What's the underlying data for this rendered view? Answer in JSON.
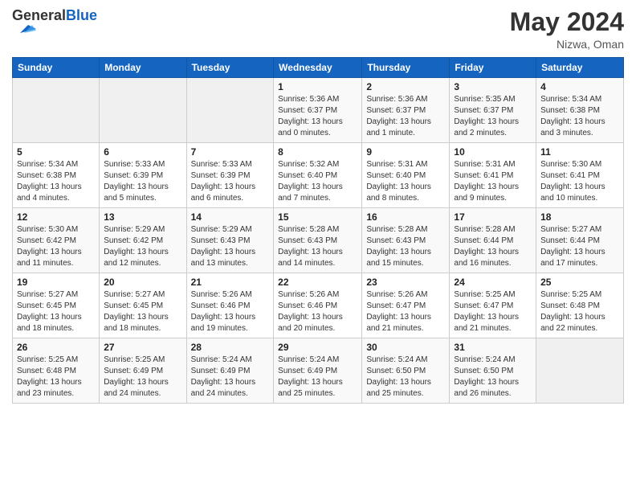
{
  "header": {
    "month_title": "May 2024",
    "location": "Nizwa, Oman",
    "logo_text": "GeneralBlue"
  },
  "calendar": {
    "days": [
      "Sunday",
      "Monday",
      "Tuesday",
      "Wednesday",
      "Thursday",
      "Friday",
      "Saturday"
    ],
    "weeks": [
      [
        {
          "day": "",
          "sunrise": "",
          "sunset": "",
          "daylight": "",
          "empty": true
        },
        {
          "day": "",
          "sunrise": "",
          "sunset": "",
          "daylight": "",
          "empty": true
        },
        {
          "day": "",
          "sunrise": "",
          "sunset": "",
          "daylight": "",
          "empty": true
        },
        {
          "day": "1",
          "sunrise": "Sunrise: 5:36 AM",
          "sunset": "Sunset: 6:37 PM",
          "daylight": "Daylight: 13 hours and 0 minutes.",
          "empty": false
        },
        {
          "day": "2",
          "sunrise": "Sunrise: 5:36 AM",
          "sunset": "Sunset: 6:37 PM",
          "daylight": "Daylight: 13 hours and 1 minute.",
          "empty": false
        },
        {
          "day": "3",
          "sunrise": "Sunrise: 5:35 AM",
          "sunset": "Sunset: 6:37 PM",
          "daylight": "Daylight: 13 hours and 2 minutes.",
          "empty": false
        },
        {
          "day": "4",
          "sunrise": "Sunrise: 5:34 AM",
          "sunset": "Sunset: 6:38 PM",
          "daylight": "Daylight: 13 hours and 3 minutes.",
          "empty": false
        }
      ],
      [
        {
          "day": "5",
          "sunrise": "Sunrise: 5:34 AM",
          "sunset": "Sunset: 6:38 PM",
          "daylight": "Daylight: 13 hours and 4 minutes.",
          "empty": false
        },
        {
          "day": "6",
          "sunrise": "Sunrise: 5:33 AM",
          "sunset": "Sunset: 6:39 PM",
          "daylight": "Daylight: 13 hours and 5 minutes.",
          "empty": false
        },
        {
          "day": "7",
          "sunrise": "Sunrise: 5:33 AM",
          "sunset": "Sunset: 6:39 PM",
          "daylight": "Daylight: 13 hours and 6 minutes.",
          "empty": false
        },
        {
          "day": "8",
          "sunrise": "Sunrise: 5:32 AM",
          "sunset": "Sunset: 6:40 PM",
          "daylight": "Daylight: 13 hours and 7 minutes.",
          "empty": false
        },
        {
          "day": "9",
          "sunrise": "Sunrise: 5:31 AM",
          "sunset": "Sunset: 6:40 PM",
          "daylight": "Daylight: 13 hours and 8 minutes.",
          "empty": false
        },
        {
          "day": "10",
          "sunrise": "Sunrise: 5:31 AM",
          "sunset": "Sunset: 6:41 PM",
          "daylight": "Daylight: 13 hours and 9 minutes.",
          "empty": false
        },
        {
          "day": "11",
          "sunrise": "Sunrise: 5:30 AM",
          "sunset": "Sunset: 6:41 PM",
          "daylight": "Daylight: 13 hours and 10 minutes.",
          "empty": false
        }
      ],
      [
        {
          "day": "12",
          "sunrise": "Sunrise: 5:30 AM",
          "sunset": "Sunset: 6:42 PM",
          "daylight": "Daylight: 13 hours and 11 minutes.",
          "empty": false
        },
        {
          "day": "13",
          "sunrise": "Sunrise: 5:29 AM",
          "sunset": "Sunset: 6:42 PM",
          "daylight": "Daylight: 13 hours and 12 minutes.",
          "empty": false
        },
        {
          "day": "14",
          "sunrise": "Sunrise: 5:29 AM",
          "sunset": "Sunset: 6:43 PM",
          "daylight": "Daylight: 13 hours and 13 minutes.",
          "empty": false
        },
        {
          "day": "15",
          "sunrise": "Sunrise: 5:28 AM",
          "sunset": "Sunset: 6:43 PM",
          "daylight": "Daylight: 13 hours and 14 minutes.",
          "empty": false
        },
        {
          "day": "16",
          "sunrise": "Sunrise: 5:28 AM",
          "sunset": "Sunset: 6:43 PM",
          "daylight": "Daylight: 13 hours and 15 minutes.",
          "empty": false
        },
        {
          "day": "17",
          "sunrise": "Sunrise: 5:28 AM",
          "sunset": "Sunset: 6:44 PM",
          "daylight": "Daylight: 13 hours and 16 minutes.",
          "empty": false
        },
        {
          "day": "18",
          "sunrise": "Sunrise: 5:27 AM",
          "sunset": "Sunset: 6:44 PM",
          "daylight": "Daylight: 13 hours and 17 minutes.",
          "empty": false
        }
      ],
      [
        {
          "day": "19",
          "sunrise": "Sunrise: 5:27 AM",
          "sunset": "Sunset: 6:45 PM",
          "daylight": "Daylight: 13 hours and 18 minutes.",
          "empty": false
        },
        {
          "day": "20",
          "sunrise": "Sunrise: 5:27 AM",
          "sunset": "Sunset: 6:45 PM",
          "daylight": "Daylight: 13 hours and 18 minutes.",
          "empty": false
        },
        {
          "day": "21",
          "sunrise": "Sunrise: 5:26 AM",
          "sunset": "Sunset: 6:46 PM",
          "daylight": "Daylight: 13 hours and 19 minutes.",
          "empty": false
        },
        {
          "day": "22",
          "sunrise": "Sunrise: 5:26 AM",
          "sunset": "Sunset: 6:46 PM",
          "daylight": "Daylight: 13 hours and 20 minutes.",
          "empty": false
        },
        {
          "day": "23",
          "sunrise": "Sunrise: 5:26 AM",
          "sunset": "Sunset: 6:47 PM",
          "daylight": "Daylight: 13 hours and 21 minutes.",
          "empty": false
        },
        {
          "day": "24",
          "sunrise": "Sunrise: 5:25 AM",
          "sunset": "Sunset: 6:47 PM",
          "daylight": "Daylight: 13 hours and 21 minutes.",
          "empty": false
        },
        {
          "day": "25",
          "sunrise": "Sunrise: 5:25 AM",
          "sunset": "Sunset: 6:48 PM",
          "daylight": "Daylight: 13 hours and 22 minutes.",
          "empty": false
        }
      ],
      [
        {
          "day": "26",
          "sunrise": "Sunrise: 5:25 AM",
          "sunset": "Sunset: 6:48 PM",
          "daylight": "Daylight: 13 hours and 23 minutes.",
          "empty": false
        },
        {
          "day": "27",
          "sunrise": "Sunrise: 5:25 AM",
          "sunset": "Sunset: 6:49 PM",
          "daylight": "Daylight: 13 hours and 24 minutes.",
          "empty": false
        },
        {
          "day": "28",
          "sunrise": "Sunrise: 5:24 AM",
          "sunset": "Sunset: 6:49 PM",
          "daylight": "Daylight: 13 hours and 24 minutes.",
          "empty": false
        },
        {
          "day": "29",
          "sunrise": "Sunrise: 5:24 AM",
          "sunset": "Sunset: 6:49 PM",
          "daylight": "Daylight: 13 hours and 25 minutes.",
          "empty": false
        },
        {
          "day": "30",
          "sunrise": "Sunrise: 5:24 AM",
          "sunset": "Sunset: 6:50 PM",
          "daylight": "Daylight: 13 hours and 25 minutes.",
          "empty": false
        },
        {
          "day": "31",
          "sunrise": "Sunrise: 5:24 AM",
          "sunset": "Sunset: 6:50 PM",
          "daylight": "Daylight: 13 hours and 26 minutes.",
          "empty": false
        },
        {
          "day": "",
          "sunrise": "",
          "sunset": "",
          "daylight": "",
          "empty": true
        }
      ]
    ]
  }
}
